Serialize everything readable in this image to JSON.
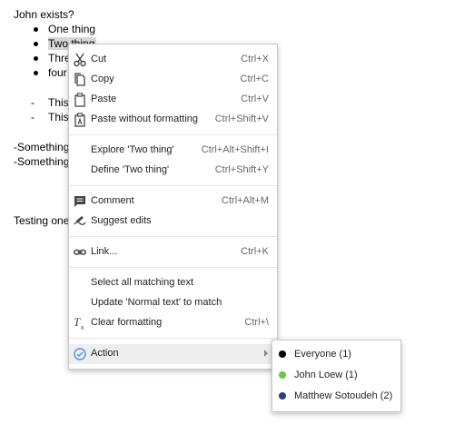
{
  "document": {
    "title_line": "John exists?",
    "bullets": [
      "One thing",
      "Two thing",
      "Thre",
      "four"
    ],
    "dash_items": [
      "This",
      "This"
    ],
    "something_lines": [
      "-Something",
      "-Something"
    ],
    "testing_line": "Testing one"
  },
  "context_menu": {
    "groups": [
      [
        {
          "icon": "scissors-icon",
          "label": "Cut",
          "shortcut": "Ctrl+X"
        },
        {
          "icon": "copy-icon",
          "label": "Copy",
          "shortcut": "Ctrl+C"
        },
        {
          "icon": "paste-icon",
          "label": "Paste",
          "shortcut": "Ctrl+V"
        },
        {
          "icon": "paste-plain-icon",
          "label": "Paste without formatting",
          "shortcut": "Ctrl+Shift+V"
        }
      ],
      [
        {
          "icon": "",
          "label": "Explore 'Two thing'",
          "shortcut": "Ctrl+Alt+Shift+I"
        },
        {
          "icon": "",
          "label": "Define 'Two thing'",
          "shortcut": "Ctrl+Shift+Y"
        }
      ],
      [
        {
          "icon": "comment-icon",
          "label": "Comment",
          "shortcut": "Ctrl+Alt+M"
        },
        {
          "icon": "suggest-edits-icon",
          "label": "Suggest edits",
          "shortcut": ""
        }
      ],
      [
        {
          "icon": "link-icon",
          "label": "Link...",
          "shortcut": "Ctrl+K"
        }
      ],
      [
        {
          "icon": "",
          "label": "Select all matching text",
          "shortcut": ""
        },
        {
          "icon": "",
          "label": "Update 'Normal text' to match",
          "shortcut": ""
        },
        {
          "icon": "clear-formatting-icon",
          "label": "Clear formatting",
          "shortcut": "Ctrl+\\"
        }
      ],
      [
        {
          "icon": "check-circle-icon",
          "label": "Action",
          "shortcut": "",
          "has_submenu": true
        }
      ]
    ]
  },
  "submenu": {
    "items": [
      {
        "label": "Everyone (1)",
        "color": "#000000"
      },
      {
        "label": "John Loew (1)",
        "color": "#6cc24a"
      },
      {
        "label": "Matthew Sotoudeh (2)",
        "color": "#2a3f7a"
      }
    ]
  },
  "colors": {
    "selection": "#d6d6d6",
    "action_icon": "#4a90e2",
    "highlight_row": "#eeeeee"
  }
}
